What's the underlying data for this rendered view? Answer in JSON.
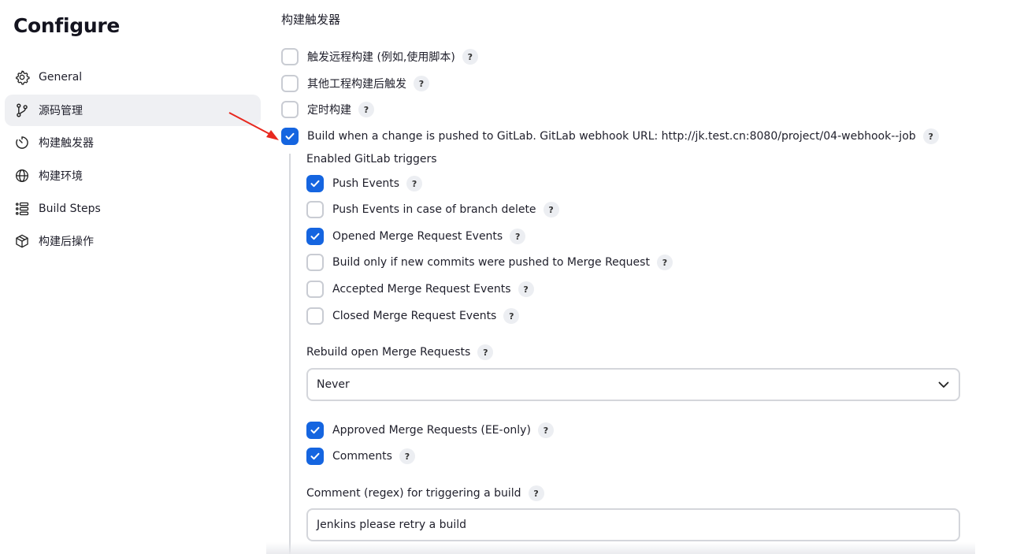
{
  "page": {
    "title": "Configure"
  },
  "sidebar": {
    "items": [
      {
        "label": "General",
        "icon": "gear-icon"
      },
      {
        "label": "源码管理",
        "icon": "branch-icon",
        "active": true
      },
      {
        "label": "构建触发器",
        "icon": "timer-icon"
      },
      {
        "label": "构建环境",
        "icon": "globe-icon"
      },
      {
        "label": "Build Steps",
        "icon": "list-icon"
      },
      {
        "label": "构建后操作",
        "icon": "package-icon"
      }
    ]
  },
  "triggers": {
    "section_title": "构建触发器",
    "options": [
      {
        "label": "触发远程构建 (例如,使用脚本)",
        "checked": false
      },
      {
        "label": "其他工程构建后触发",
        "checked": false
      },
      {
        "label": "定时构建",
        "checked": false
      },
      {
        "label": "Build when a change is pushed to GitLab. GitLab webhook URL: http://jk.test.cn:8080/project/04-webhook--job",
        "checked": true
      }
    ]
  },
  "gitlab": {
    "enabled_triggers_label": "Enabled GitLab triggers",
    "events": [
      {
        "label": "Push Events",
        "checked": true
      },
      {
        "label": "Push Events in case of branch delete",
        "checked": false
      },
      {
        "label": "Opened Merge Request Events",
        "checked": true
      },
      {
        "label": "Build only if new commits were pushed to Merge Request",
        "checked": false
      },
      {
        "label": "Accepted Merge Request Events",
        "checked": false
      },
      {
        "label": "Closed Merge Request Events",
        "checked": false
      }
    ],
    "rebuild_label": "Rebuild open Merge Requests",
    "rebuild_value": "Never",
    "extra": [
      {
        "label": "Approved Merge Requests (EE-only)",
        "checked": true
      },
      {
        "label": "Comments",
        "checked": true
      }
    ],
    "comment_label": "Comment (regex) for triggering a build",
    "comment_value": "Jenkins please retry a build"
  },
  "help_glyph": "?",
  "colors": {
    "accent": "#1565e0",
    "arrow": "#e8281e",
    "active_bg": "#eff0f3"
  }
}
